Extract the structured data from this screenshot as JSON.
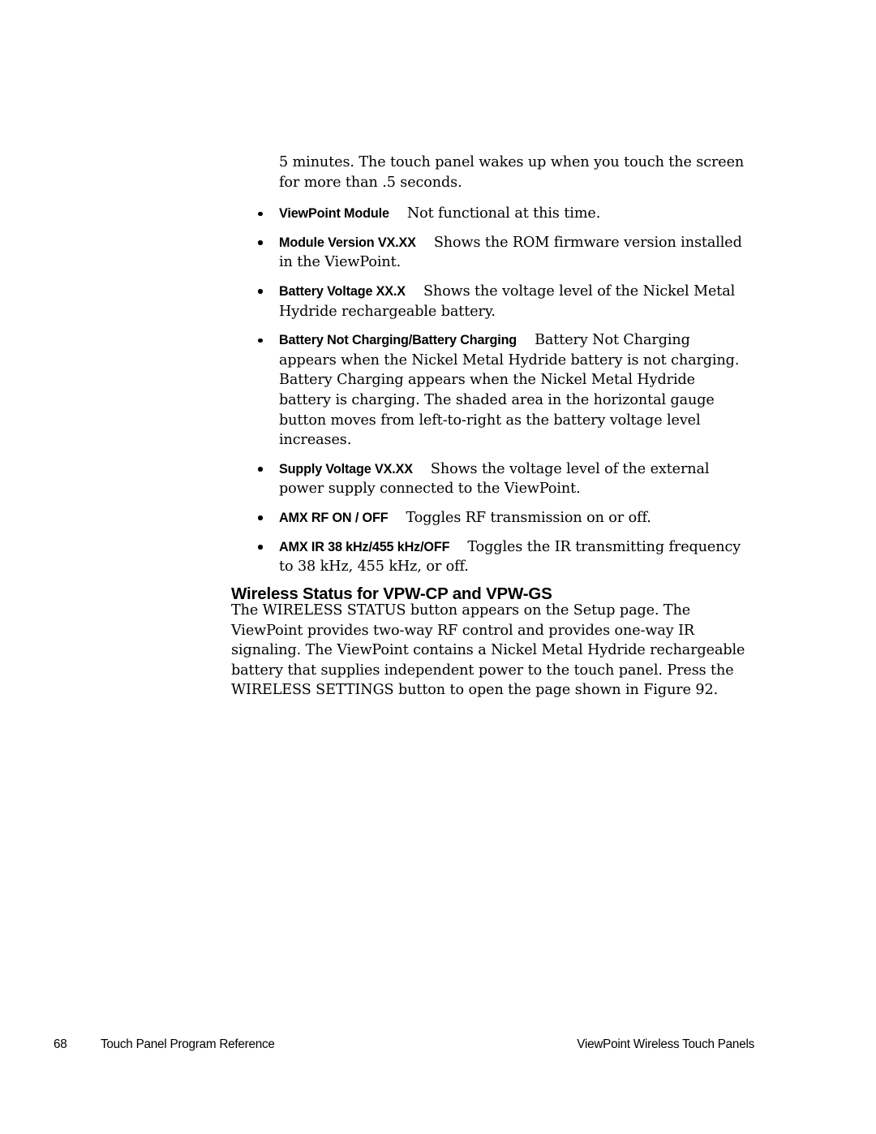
{
  "document": {
    "intro_paragraph": "5 minutes. The touch panel wakes up when you touch the screen for more than .5 seconds.",
    "bullets": [
      {
        "term": "ViewPoint Module",
        "description": "Not functional at this time."
      },
      {
        "term": "Module Version VX.XX",
        "description": "Shows the ROM firmware version installed in the ViewPoint."
      },
      {
        "term": "Battery Voltage XX.X",
        "description": "Shows the voltage level of the Nickel Metal Hydride rechargeable battery."
      },
      {
        "term": "Battery Not Charging/Battery Charging",
        "description": "Battery Not Charging appears when the Nickel Metal Hydride battery is not charging. Battery Charging appears when the Nickel Metal Hydride battery is charging. The shaded area in the horizontal gauge button moves from left-to-right as the battery voltage level increases."
      },
      {
        "term": "Supply Voltage VX.XX",
        "description": "Shows the voltage level of the external power supply connected to the ViewPoint."
      },
      {
        "term": "AMX RF ON / OFF",
        "description": "Toggles RF transmission on or off."
      },
      {
        "term": "AMX IR 38 kHz/455 kHz/OFF",
        "description": "Toggles the IR transmitting frequency to 38 kHz, 455 kHz, or off."
      }
    ],
    "section": {
      "heading": "Wireless Status for VPW-CP and VPW-GS",
      "paragraph": "The WIRELESS STATUS button appears on the Setup page. The ViewPoint provides two-way RF control and provides one-way IR signaling. The ViewPoint contains a Nickel Metal Hydride rechargeable battery that supplies independent power to the touch panel. Press the WIRELESS SETTINGS button to open the page shown in Figure 92."
    }
  },
  "footer": {
    "page_number": "68",
    "left_text": "Touch Panel Program Reference",
    "right_text": "ViewPoint Wireless Touch Panels"
  }
}
